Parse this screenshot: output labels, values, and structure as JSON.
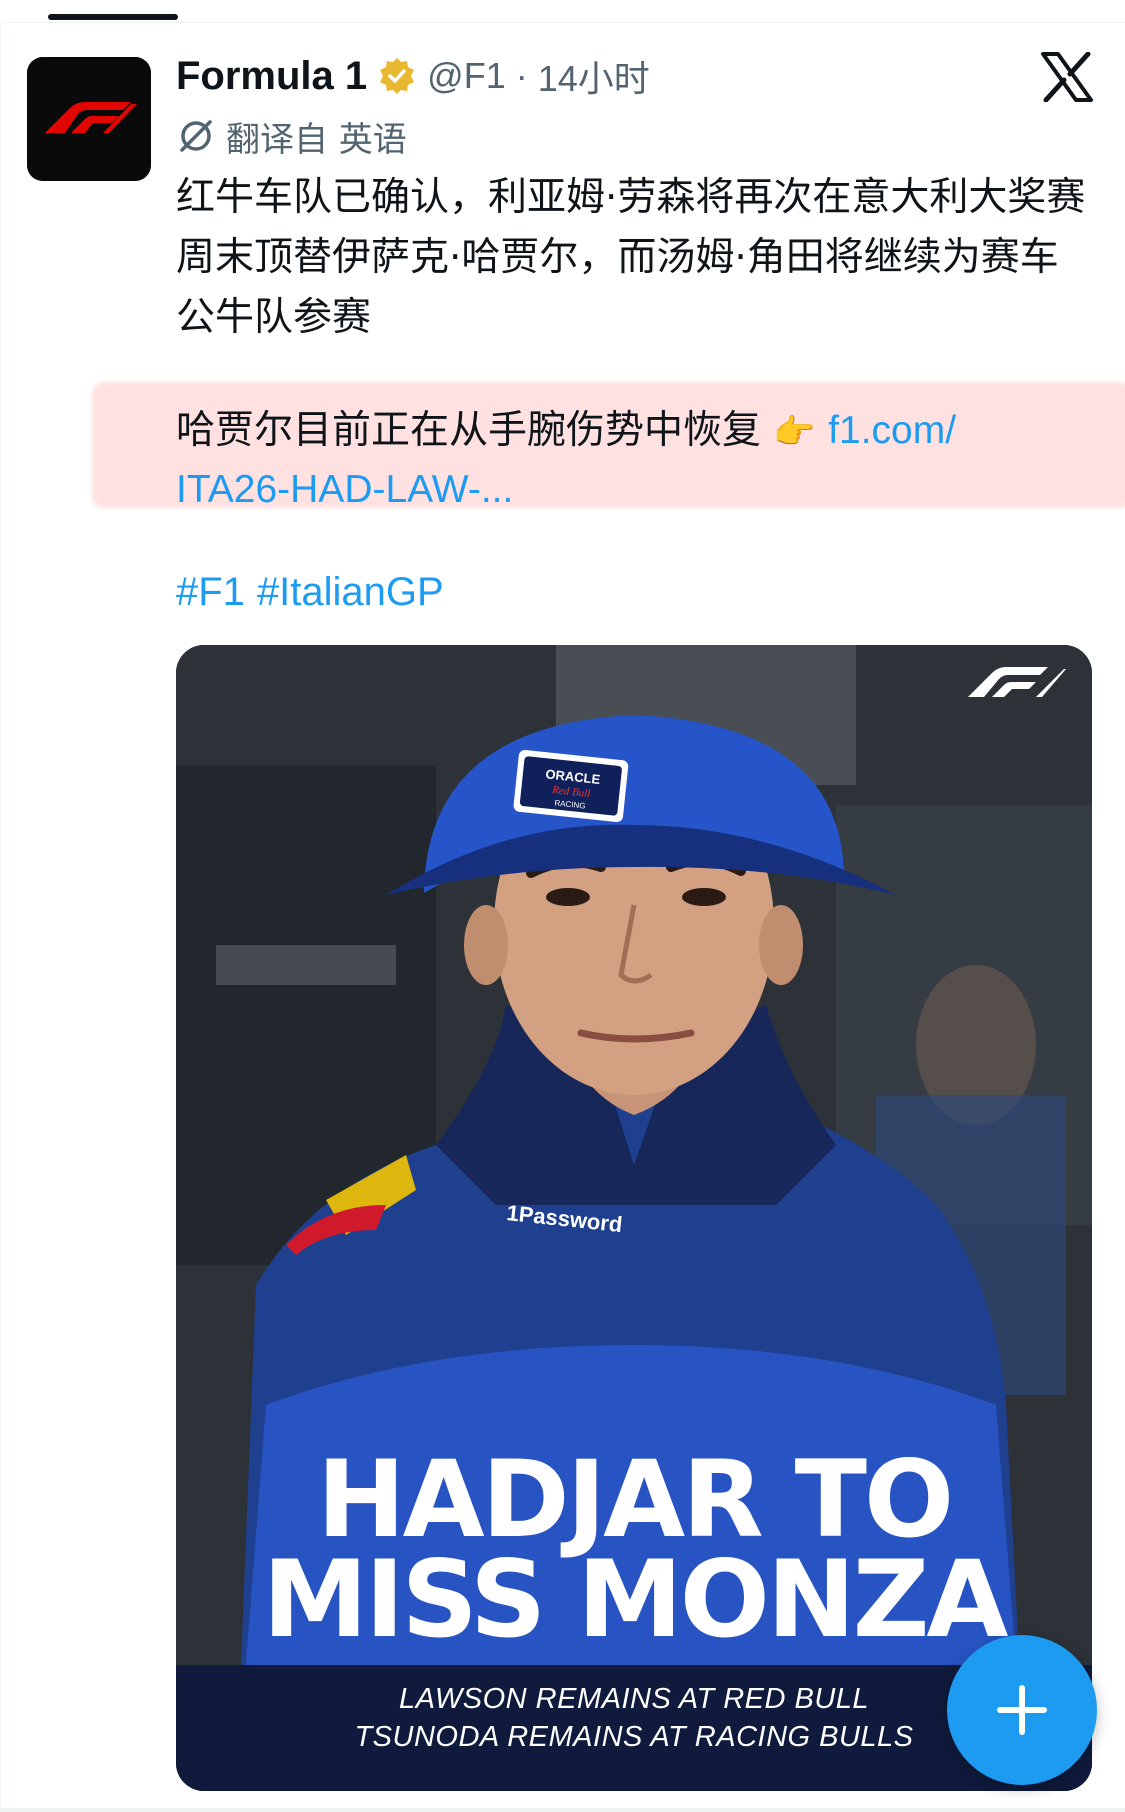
{
  "tweet": {
    "author_name": "Formula 1",
    "handle": "@F1",
    "separator": "·",
    "time": "14小时",
    "translated_from": "翻译自 英语",
    "body": "红牛车队已确认，利亚姆·劳森将再次在意大利大奖赛周末顶替伊萨克·哈贾尔，而汤姆·角田将继续为赛车公牛队参赛",
    "second_para": "哈贾尔目前正在从手腕伤势中恢复",
    "pointer_emoji": "👉",
    "link_part1": "f1.com/",
    "link_part2": "ITA26-HAD-LAW-...",
    "hashtags": [
      "#F1",
      "#ItalianGP"
    ]
  },
  "media": {
    "headline_line1": "HADJAR TO",
    "headline_line2": "MISS MONZA",
    "subline1": "LAWSON REMAINS AT RED BULL",
    "subline2": "TSUNODA REMAINS AT RACING BULLS",
    "cap_text_top": "ORACLE",
    "cap_text_mid": "Red Bull",
    "cap_text_bottom": "RACING",
    "jacket_sponsor": "1Password"
  },
  "colors": {
    "link": "#1d9bf0",
    "f1_red": "#e10600",
    "verified_gold": "#e8b830",
    "fab": "#1d9bf0"
  },
  "icons": {
    "verified": "verified-badge-icon",
    "close": "x-logo-icon",
    "translate": "translate-icon",
    "compose": "plus-icon"
  }
}
